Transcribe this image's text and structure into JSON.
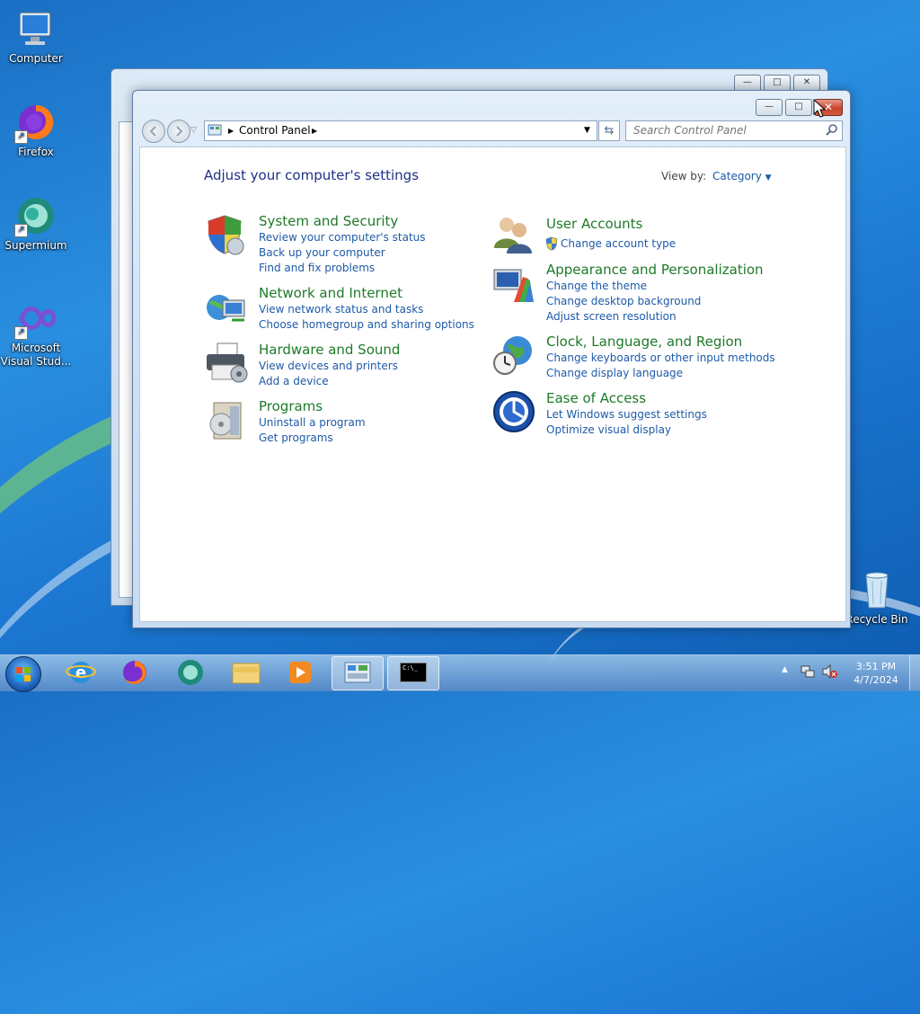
{
  "desktop": {
    "icons": [
      {
        "label": "Computer"
      },
      {
        "label": "Firefox"
      },
      {
        "label": "Supermium"
      },
      {
        "label_line1": "Microsoft",
        "label_line2": "Visual Stud..."
      },
      {
        "label": "Recycle Bin"
      }
    ]
  },
  "window": {
    "address_path": "Control Panel",
    "search_placeholder": "Search Control Panel",
    "title_buttons": {
      "minimize": "—",
      "maximize": "□",
      "close": "✕"
    }
  },
  "panel": {
    "heading": "Adjust your computer's settings",
    "view_by_label": "View by:",
    "view_by_value": "Category",
    "categories": [
      {
        "title": "System and Security",
        "icon": "shield-icon",
        "links": [
          "Review your computer's status",
          "Back up your computer",
          "Find and fix problems"
        ]
      },
      {
        "title": "Network and Internet",
        "icon": "network-icon",
        "links": [
          "View network status and tasks",
          "Choose homegroup and sharing options"
        ]
      },
      {
        "title": "Hardware and Sound",
        "icon": "printer-icon",
        "links": [
          "View devices and printers",
          "Add a device"
        ]
      },
      {
        "title": "Programs",
        "icon": "programs-icon",
        "links": [
          "Uninstall a program",
          "Get programs"
        ]
      },
      {
        "title": "User Accounts",
        "icon": "users-icon",
        "links": [
          "Change account type"
        ]
      },
      {
        "title": "Appearance and Personalization",
        "icon": "appearance-icon",
        "links": [
          "Change the theme",
          "Change desktop background",
          "Adjust screen resolution"
        ]
      },
      {
        "title": "Clock, Language, and Region",
        "icon": "clock-globe-icon",
        "links": [
          "Change keyboards or other input methods",
          "Change display language"
        ]
      },
      {
        "title": "Ease of Access",
        "icon": "ease-of-access-icon",
        "links": [
          "Let Windows suggest settings",
          "Optimize visual display"
        ]
      }
    ]
  },
  "taskbar": {
    "time": "3:51 PM",
    "date": "4/7/2024",
    "cmd_glyph": "C:\\_",
    "items": [
      "start-button",
      "internet-explorer-icon",
      "firefox-icon",
      "supermium-icon",
      "file-explorer-icon",
      "media-player-icon",
      "control-panel-icon",
      "command-prompt-icon"
    ]
  },
  "colors": {
    "title_green": "#1e7a2a",
    "link_blue": "#1e5aa8",
    "heading_navy": "#1e3287"
  }
}
